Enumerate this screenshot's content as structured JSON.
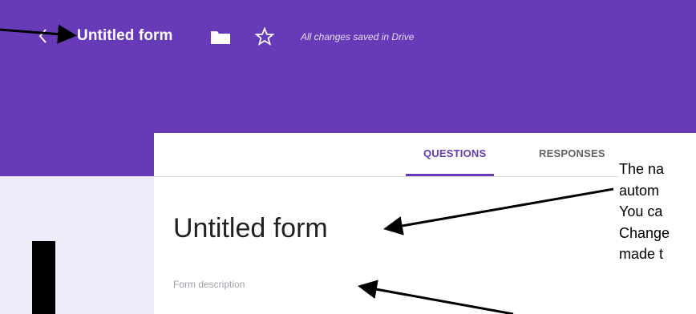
{
  "header": {
    "title": "Untitled form",
    "save_status": "All changes saved in Drive",
    "accent_color": "#673ab7",
    "icons": [
      "back-arrow-icon",
      "folder-icon",
      "star-icon"
    ]
  },
  "tabs": [
    {
      "label": "QUESTIONS",
      "active": true
    },
    {
      "label": "RESPONSES",
      "active": false
    }
  ],
  "form": {
    "title": "Untitled form",
    "description_placeholder": "Form description"
  },
  "annotation": {
    "lines": [
      "The na",
      "autom",
      "You ca",
      "Change",
      "made t"
    ]
  }
}
